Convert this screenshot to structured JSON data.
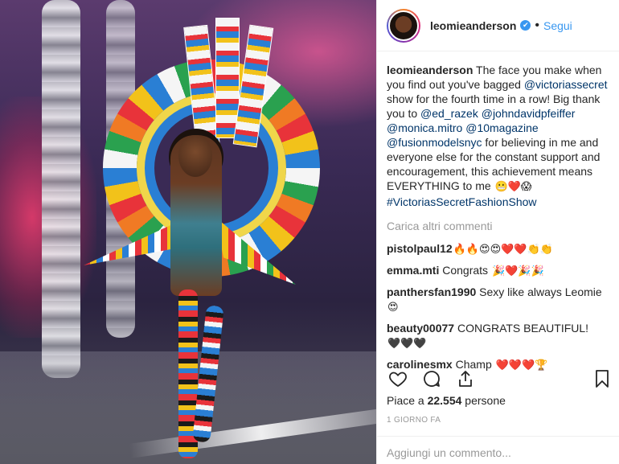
{
  "header": {
    "username": "leomieanderson",
    "verified_mark": "✔",
    "separator": "•",
    "follow_label": "Segui"
  },
  "caption": {
    "username": "leomieanderson",
    "text_1": " The face you make when you find out you've bagged ",
    "mention_1": "@victoriassecret",
    "text_2": " show for the fourth time in a row! Big thank you to ",
    "mention_2": "@ed_razek",
    "text_3": " ",
    "mention_3": "@johndavidpfeiffer",
    "text_4": " ",
    "mention_4": "@monica.mitro",
    "text_5": " ",
    "mention_5": "@10magazine",
    "text_6": " ",
    "mention_6": "@fusionmodelsnyc",
    "text_7": " for believing in me and everyone else for the constant support and encouragement, this achievement means EVERYTHING to me ",
    "emojis": "😬❤️😱",
    "hashtag": "#VictoriasSecretFashionShow"
  },
  "load_more_label": "Carica altri commenti",
  "comments": [
    {
      "user": "pistolpaul12",
      "text": "",
      "emojis": "🔥🔥😍😍❤️❤️👏👏"
    },
    {
      "user": "emma.mti",
      "text": " Congrats ",
      "emojis": "🎉❤️🎉🎉"
    },
    {
      "user": "panthersfan1990",
      "text": " Sexy like always Leomie ",
      "emojis": "😍"
    },
    {
      "user": "beauty00077",
      "text": " CONGRATS BEAUTIFUL!",
      "emojis": "🖤🖤🖤"
    },
    {
      "user": "carolinesmx",
      "text": " Champ ",
      "emojis": "❤️❤️❤️🏆"
    }
  ],
  "actions": {
    "like_icon": "heart-icon",
    "comment_icon": "comment-icon",
    "share_icon": "share-icon",
    "save_icon": "bookmark-icon"
  },
  "likes": {
    "prefix": "Piace a ",
    "count": "22.554",
    "suffix": " persone"
  },
  "timestamp": "1 GIORNO FA",
  "comment_input": {
    "placeholder": "Aggiungi un commento..."
  }
}
